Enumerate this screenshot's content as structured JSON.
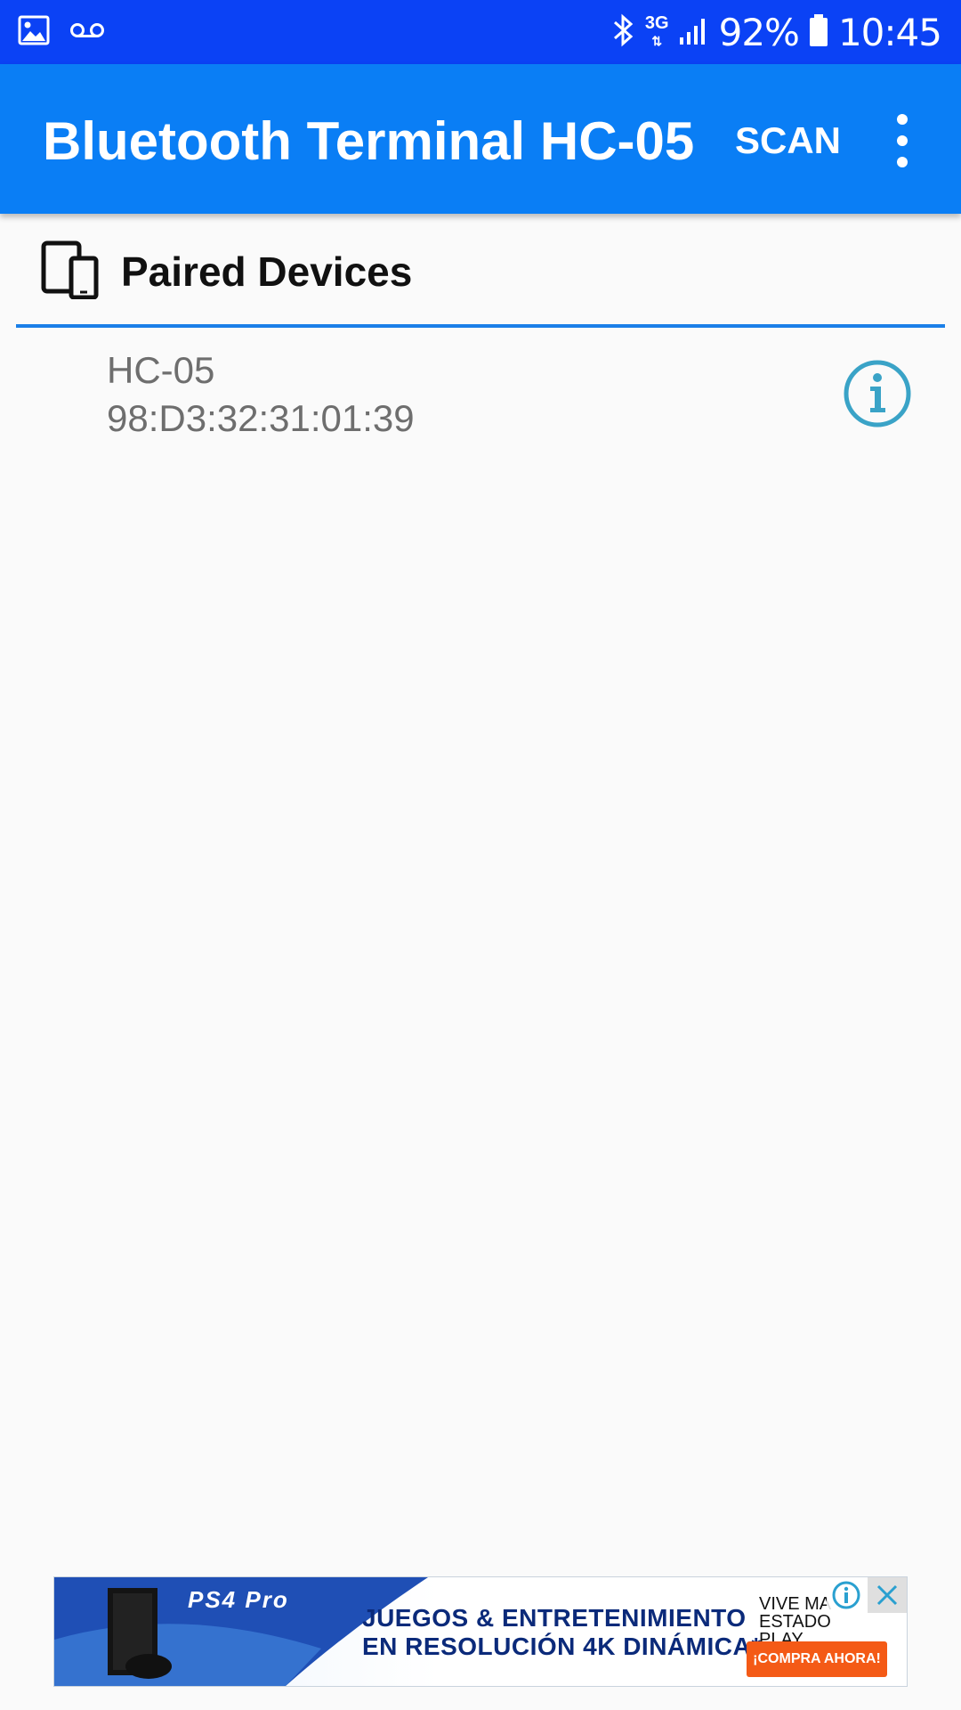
{
  "status_bar": {
    "icons_left": [
      "image-icon",
      "voicemail-icon"
    ],
    "icons_right": [
      "bluetooth-icon",
      "network-3g-icon",
      "signal-icon",
      "battery-icon"
    ],
    "network_type": "3G",
    "battery": "92%",
    "time": "10:45"
  },
  "app_bar": {
    "title": "Bluetooth Terminal HC-05",
    "scan_label": "SCAN",
    "overflow_icon": "more-vert-icon",
    "color": "#0a7ef5"
  },
  "section": {
    "icon": "devices-icon",
    "title": "Paired Devices",
    "divider_color": "#1a7fe8"
  },
  "devices": [
    {
      "name": "HC-05",
      "address": "98:D3:32:31:01:39",
      "icon": "info-icon"
    }
  ],
  "ad": {
    "brand_logo": "PS4 Pro",
    "headline_line1": "JUEGOS & ENTRETENIMIENTO",
    "headline_line2": "EN RESOLUCIÓN 4K DINÁMICA*",
    "slogan_line1": "VIVE MA",
    "slogan_line2": "ESTADO PLAY",
    "cta": "¡COMPRA AHORA!",
    "cta_color": "#f45a16"
  },
  "colors": {
    "status_bar": "#0b42f5",
    "background": "#fafafa",
    "info_icon": "#3aa3c7"
  }
}
